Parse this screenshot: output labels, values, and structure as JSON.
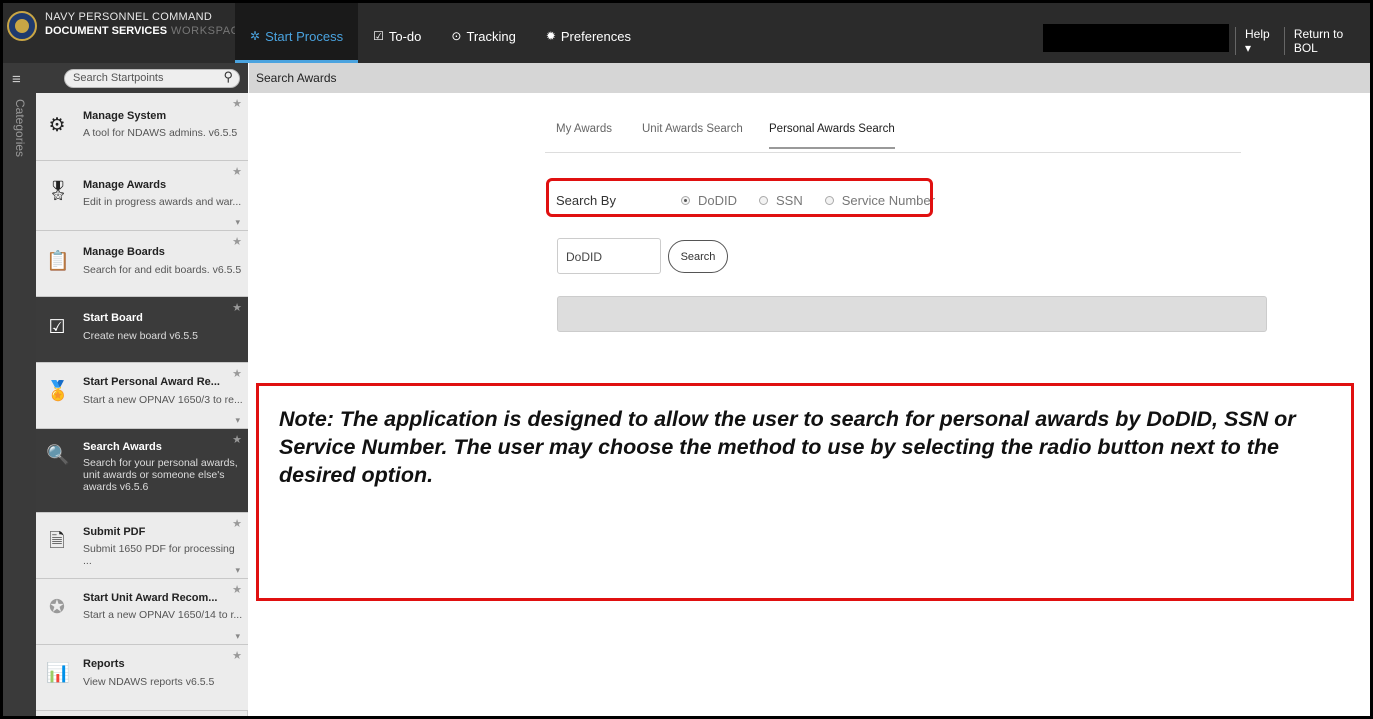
{
  "header": {
    "org_line1": "NAVY PERSONNEL COMMAND",
    "org_line2": "DOCUMENT SERVICES",
    "org_workspace": "WORKSPACE",
    "nav": [
      {
        "label": "Start Process",
        "icon": "gear-outline-icon"
      },
      {
        "label": "To-do",
        "icon": "checkbox-icon"
      },
      {
        "label": "Tracking",
        "icon": "target-icon"
      },
      {
        "label": "Preferences",
        "icon": "gear-icon"
      }
    ],
    "help_label": "Help ▾",
    "return_label": "Return to BOL"
  },
  "sidebar": {
    "categories_label": "Categories",
    "search_placeholder": "Search Startpoints",
    "items": [
      {
        "title": "Manage System",
        "desc": "A tool for NDAWS admins. v6.5.5"
      },
      {
        "title": "Manage Awards",
        "desc": "Edit in progress awards and war..."
      },
      {
        "title": "Manage Boards",
        "desc": "Search for and edit boards. v6.5.5"
      },
      {
        "title": "Start Board",
        "desc": "Create new board v6.5.5"
      },
      {
        "title": "Start Personal Award Re...",
        "desc": "Start a new OPNAV 1650/3 to re..."
      },
      {
        "title": "Search Awards",
        "desc": "Search for your personal awards, unit awards or someone else's awards v6.5.6"
      },
      {
        "title": "Submit PDF",
        "desc": "Submit 1650 PDF for processing ..."
      },
      {
        "title": "Start Unit Award Recom...",
        "desc": "Start a new OPNAV 1650/14 to r..."
      },
      {
        "title": "Reports",
        "desc": "View NDAWS reports v6.5.5"
      }
    ]
  },
  "main": {
    "breadcrumb": "Search Awards",
    "tabs": [
      "My Awards",
      "Unit Awards Search",
      "Personal Awards Search"
    ],
    "search_by_label": "Search By",
    "radio_options": [
      "DoDID",
      "SSN",
      "Service Number"
    ],
    "selected_option": "DoDID",
    "input_placeholder": "DoDID",
    "search_button": "Search",
    "note": "Note:  The application is designed to allow the user to search for personal awards by DoDID, SSN or Service Number.  The user may choose the method to use by selecting the radio button next to the desired option."
  },
  "colors": {
    "highlight": "#e01010",
    "accent": "#4aa3df",
    "topbar": "#2b2b2b"
  }
}
